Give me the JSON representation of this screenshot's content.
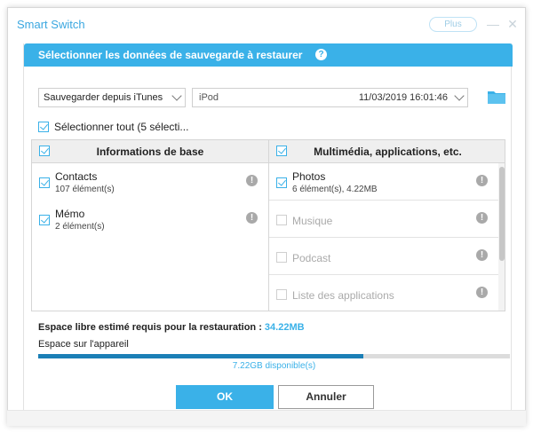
{
  "window": {
    "app_title": "Smart Switch",
    "plus_label": "Plus",
    "minimize_glyph": "—",
    "close_glyph": "✕"
  },
  "dialog": {
    "title": "Sélectionner les données de sauvegarde à restaurer",
    "help_glyph": "?"
  },
  "source_select": {
    "value": "Sauvegarder depuis iTunes"
  },
  "device_select": {
    "device": "iPod",
    "date": "11/03/2019 16:01:46"
  },
  "select_all": {
    "label": "Sélectionner tout (5 sélecti...",
    "checked": true
  },
  "left_column": {
    "header": "Informations de base",
    "checked": true,
    "items": [
      {
        "name": "Contacts",
        "detail": "107 élément(s)",
        "checked": true,
        "enabled": true
      },
      {
        "name": "Mémo",
        "detail": "2 élément(s)",
        "checked": true,
        "enabled": true
      }
    ]
  },
  "right_column": {
    "header": "Multimédia, applications, etc.",
    "checked": true,
    "items": [
      {
        "name": "Photos",
        "detail": "6 élément(s), 4.22MB",
        "checked": true,
        "enabled": true
      },
      {
        "name": "Musique",
        "detail": "",
        "checked": false,
        "enabled": false
      },
      {
        "name": "Podcast",
        "detail": "",
        "checked": false,
        "enabled": false
      },
      {
        "name": "Liste des applications",
        "detail": "",
        "checked": false,
        "enabled": false
      }
    ]
  },
  "info_glyph": "!",
  "storage": {
    "required_label": "Espace libre estimé requis pour la restauration : ",
    "required_value": "34.22MB",
    "device_label": "Espace sur l'appareil",
    "used_fraction": 0.69,
    "available_text": "7.22GB disponible(s)"
  },
  "buttons": {
    "ok": "OK",
    "cancel": "Annuler"
  },
  "colors": {
    "accent": "#3ab1e8",
    "progress": "#1b7fb6"
  }
}
